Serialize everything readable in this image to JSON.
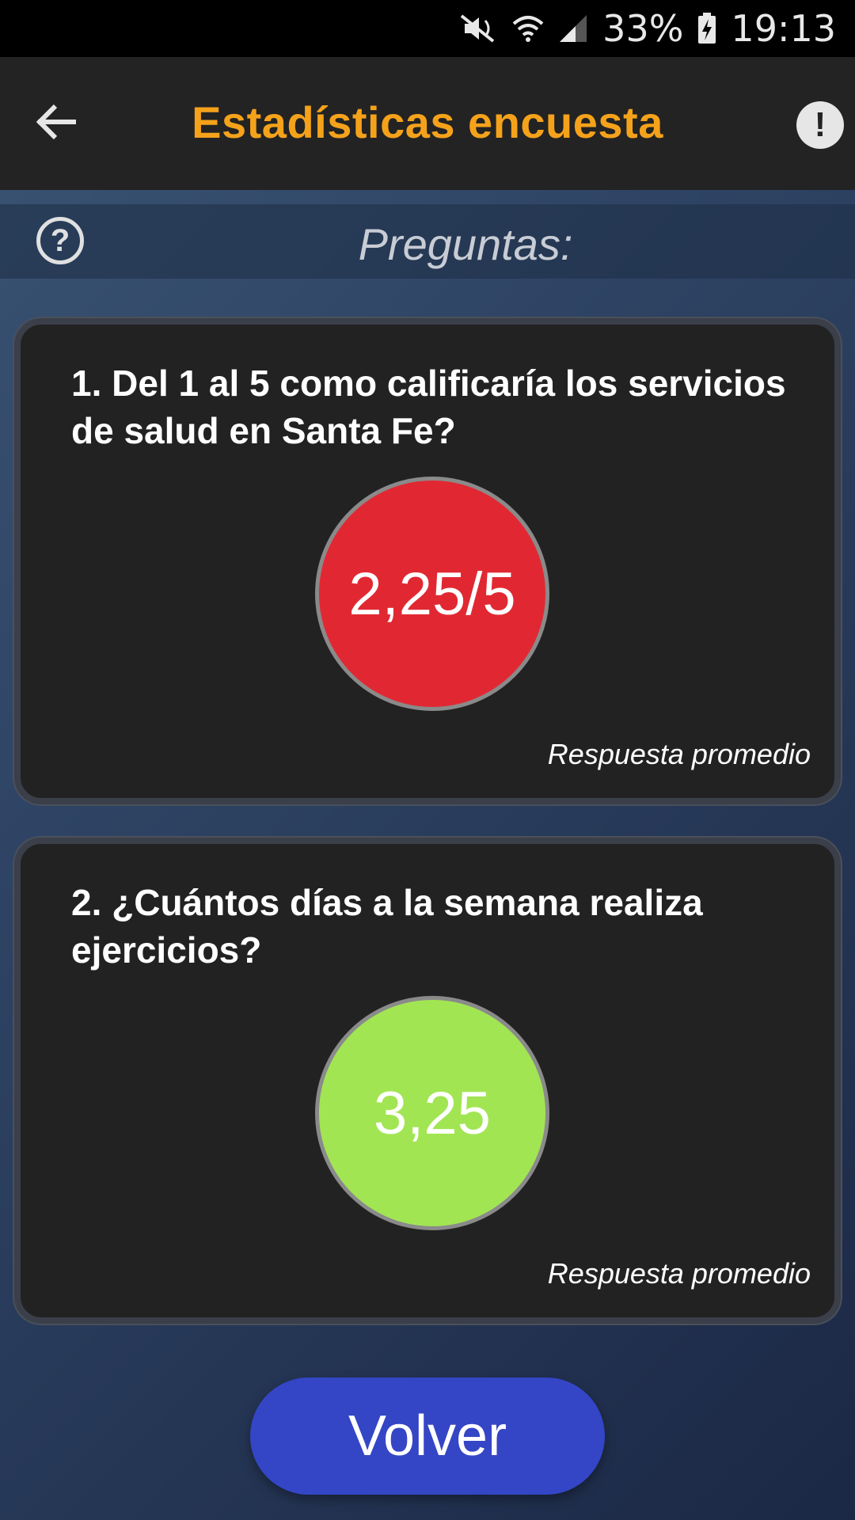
{
  "status_bar": {
    "battery": "33%",
    "time": "19:13",
    "icons": [
      "mute-icon",
      "wifi-icon",
      "signal-icon",
      "battery-charging-icon"
    ]
  },
  "app_bar": {
    "title": "Estadísticas encuesta",
    "back_icon": "arrow-left-icon",
    "info_icon": "exclamation-icon",
    "info_label": "!"
  },
  "section": {
    "help_label": "?",
    "title": "Preguntas:"
  },
  "questions": [
    {
      "text": "1. Del 1 al 5 como calificaría los servicios de salud en Santa Fe?",
      "score": "2,25/5",
      "score_color": "#e12832",
      "caption": "Respuesta promedio"
    },
    {
      "text": "2. ¿Cuántos días a la semana realiza ejercicios?",
      "score": "3,25",
      "score_color": "#a2e553",
      "caption": "Respuesta promedio"
    }
  ],
  "footer": {
    "button_label": "Volver"
  },
  "colors": {
    "accent": "#f5a21b",
    "button": "#3446c6",
    "card": "#222222"
  }
}
